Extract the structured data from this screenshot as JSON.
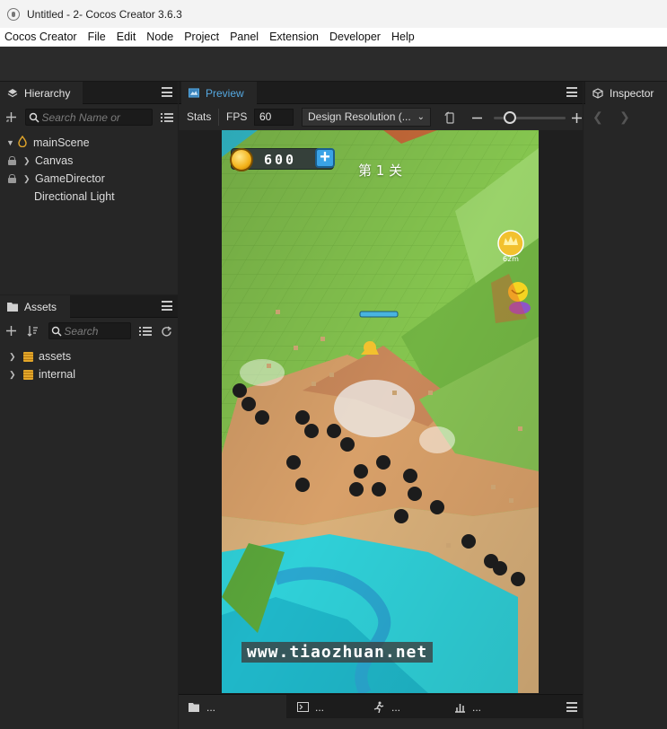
{
  "window": {
    "title": "Untitled - 2- Cocos Creator 3.6.3"
  },
  "menubar": [
    "Cocos Creator",
    "File",
    "Edit",
    "Node",
    "Project",
    "Panel",
    "Extension",
    "Developer",
    "Help"
  ],
  "hierarchy": {
    "tab_label": "Hierarchy",
    "search_placeholder": "Search Name or",
    "tree": [
      {
        "label": "mainScene",
        "icon": "scene-icon",
        "expanded": true
      },
      {
        "label": "Canvas",
        "locked": true
      },
      {
        "label": "GameDirector",
        "locked": true
      },
      {
        "label": "Directional Light"
      }
    ]
  },
  "assets": {
    "tab_label": "Assets",
    "search_placeholder": "Search",
    "tree": [
      {
        "label": "assets",
        "icon": "folder-icon"
      },
      {
        "label": "internal",
        "icon": "folder-icon"
      }
    ]
  },
  "preview": {
    "tab_label": "Preview",
    "stats_label": "Stats",
    "fps_label": "FPS",
    "fps_value": "60",
    "resolution_label": "Design Resolution (..."
  },
  "game": {
    "coins": "600",
    "level": "第 1 关",
    "distance": "62m",
    "watermark": "www.tiaozhuan.net"
  },
  "inspector": {
    "tab_label": "Inspector"
  },
  "bottom_tabs": [
    {
      "label": "...",
      "icon": "folder-icon"
    },
    {
      "label": "...",
      "icon": "console-icon"
    },
    {
      "label": "...",
      "icon": "runner-icon"
    },
    {
      "label": "...",
      "icon": "profiler-icon"
    }
  ],
  "colors": {
    "accent": "#3aa3e6",
    "panel_bg": "#262626",
    "tab_active_text": "#55a8e0"
  }
}
